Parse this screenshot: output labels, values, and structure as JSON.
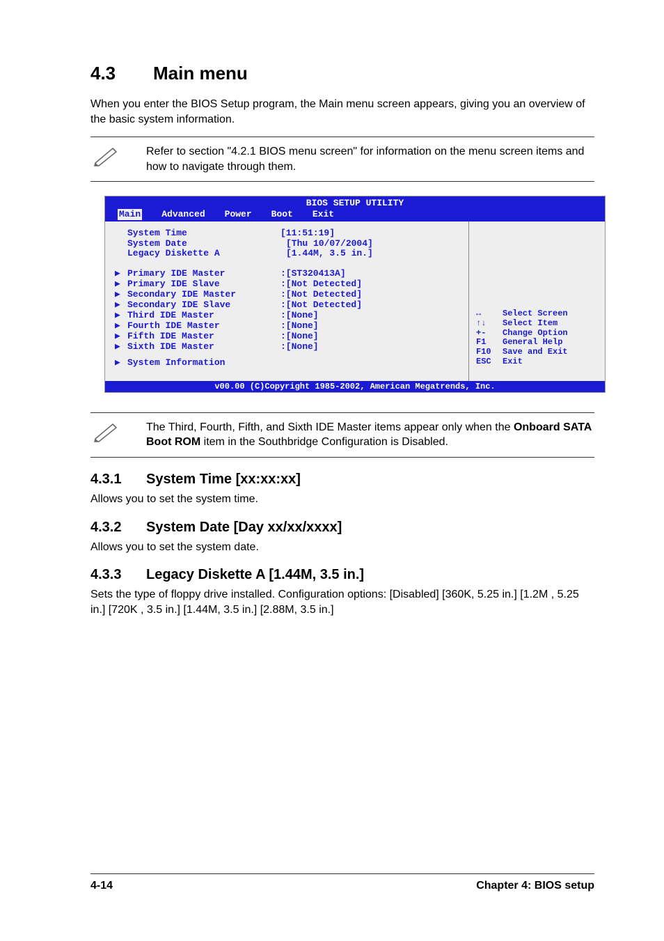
{
  "section": {
    "number": "4.3",
    "title": "Main menu",
    "intro": "When you enter the BIOS Setup program, the Main menu screen appears, giving you an overview of the basic system information."
  },
  "note_top": "Refer to section \"4.2.1  BIOS menu screen\" for information on the menu screen items and how to navigate through them.",
  "bios": {
    "title": "BIOS SETUP UTILITY",
    "menus": [
      "Main",
      "Advanced",
      "Power",
      "Boot",
      "Exit"
    ],
    "selected_menu": "Main",
    "top_items": [
      {
        "label": "System Time",
        "value": "[11:51:19]"
      },
      {
        "label": "System Date",
        "value": "[Thu 10/07/2004]"
      },
      {
        "label": "Legacy Diskette A",
        "value": "[1.44M, 3.5 in.]"
      }
    ],
    "sub_items": [
      {
        "label": "Primary IDE Master",
        "value": ":[ST320413A]"
      },
      {
        "label": "Primary IDE Slave",
        "value": ":[Not Detected]"
      },
      {
        "label": "Secondary IDE Master",
        "value": ":[Not Detected]"
      },
      {
        "label": "Secondary IDE Slave",
        "value": ":[Not Detected]"
      },
      {
        "label": "Third IDE Master",
        "value": ":[None]"
      },
      {
        "label": "Fourth IDE Master",
        "value": ":[None]"
      },
      {
        "label": "Fifth IDE Master",
        "value": ":[None]"
      },
      {
        "label": "Sixth IDE Master",
        "value": ":[None]"
      }
    ],
    "extra_item": {
      "label": "System Information"
    },
    "help": [
      {
        "key": "↔",
        "action": "Select Screen"
      },
      {
        "key": "↑↓",
        "action": "Select Item"
      },
      {
        "key": "+-",
        "action": "Change Option"
      },
      {
        "key": "F1",
        "action": "General Help"
      },
      {
        "key": "F10",
        "action": "Save and Exit"
      },
      {
        "key": "ESC",
        "action": "Exit"
      }
    ],
    "copyright": "v00.00 (C)Copyright 1985-2002, American Megatrends, Inc."
  },
  "note_middle_pre": "The Third, Fourth, Fifth, and Sixth IDE Master items appear only when the ",
  "note_middle_bold": "Onboard SATA Boot ROM",
  "note_middle_post": " item in the Southbridge Configuration is Disabled.",
  "subs": {
    "s1": {
      "num": "4.3.1",
      "title": "System Time [xx:xx:xx]",
      "body": "Allows you to set the system time."
    },
    "s2": {
      "num": "4.3.2",
      "title": "System Date [Day xx/xx/xxxx]",
      "body": "Allows you to set the system date."
    },
    "s3": {
      "num": "4.3.3",
      "title": "Legacy Diskette A [1.44M, 3.5 in.]",
      "body": "Sets the type of floppy drive installed. Configuration options: [Disabled] [360K, 5.25 in.] [1.2M , 5.25 in.] [720K , 3.5 in.] [1.44M, 3.5 in.] [2.88M, 3.5 in.]"
    }
  },
  "footer": {
    "page": "4-14",
    "chapter": "Chapter 4: BIOS setup"
  }
}
